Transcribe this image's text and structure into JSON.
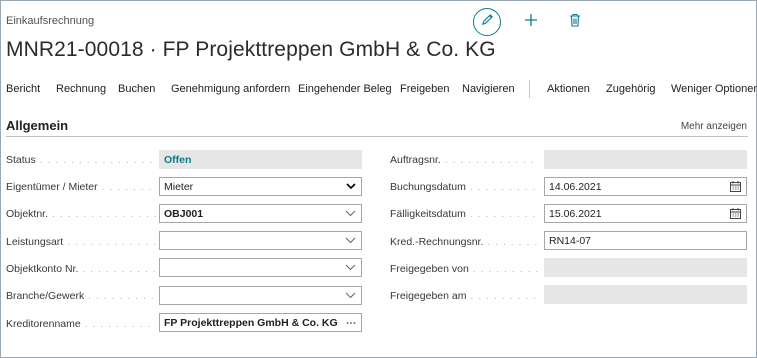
{
  "page": {
    "type_label": "Einkaufsrechnung",
    "title": "MNR21-00018 · FP Projekttreppen GmbH & Co. KG"
  },
  "header_actions": [
    {
      "icon": "pencil-icon"
    },
    {
      "icon": "plus-icon"
    },
    {
      "icon": "trash-icon"
    }
  ],
  "actionbar": {
    "items": [
      "Bericht",
      "Rechnung",
      "Buchen",
      "Genehmigung anfordern",
      "Eingehender Beleg",
      "Freigeben",
      "Navigieren",
      "Aktionen",
      "Zugehörig",
      "Weniger Optionen"
    ]
  },
  "group": {
    "title": "Allgemein",
    "show_more": "Mehr anzeigen"
  },
  "fields_left": [
    {
      "label": "Status",
      "value": "Offen"
    },
    {
      "label": "Eigentümer / Mieter",
      "value": "Mieter"
    },
    {
      "label": "Objektnr.",
      "value": "OBJ001"
    },
    {
      "label": "Leistungsart",
      "value": ""
    },
    {
      "label": "Objektkonto Nr.",
      "value": ""
    },
    {
      "label": "Branche/Gewerk",
      "value": ""
    },
    {
      "label": "Kreditorenname",
      "value": "FP Projekttreppen GmbH & Co. KG"
    }
  ],
  "fields_right": [
    {
      "label": "Auftragsnr.",
      "value": ""
    },
    {
      "label": "Buchungsdatum",
      "value": "14.06.2021"
    },
    {
      "label": "Fälligkeitsdatum",
      "value": "15.06.2021"
    },
    {
      "label": "Kred.-Rechnungsnr.",
      "value": "RN14-07"
    },
    {
      "label": "Freigegeben von",
      "value": ""
    },
    {
      "label": "Freigegeben am",
      "value": ""
    }
  ],
  "colors": {
    "accent": "#0d7c8a",
    "readonly_bg": "#e6e6e6",
    "border": "#a6a6a6"
  }
}
